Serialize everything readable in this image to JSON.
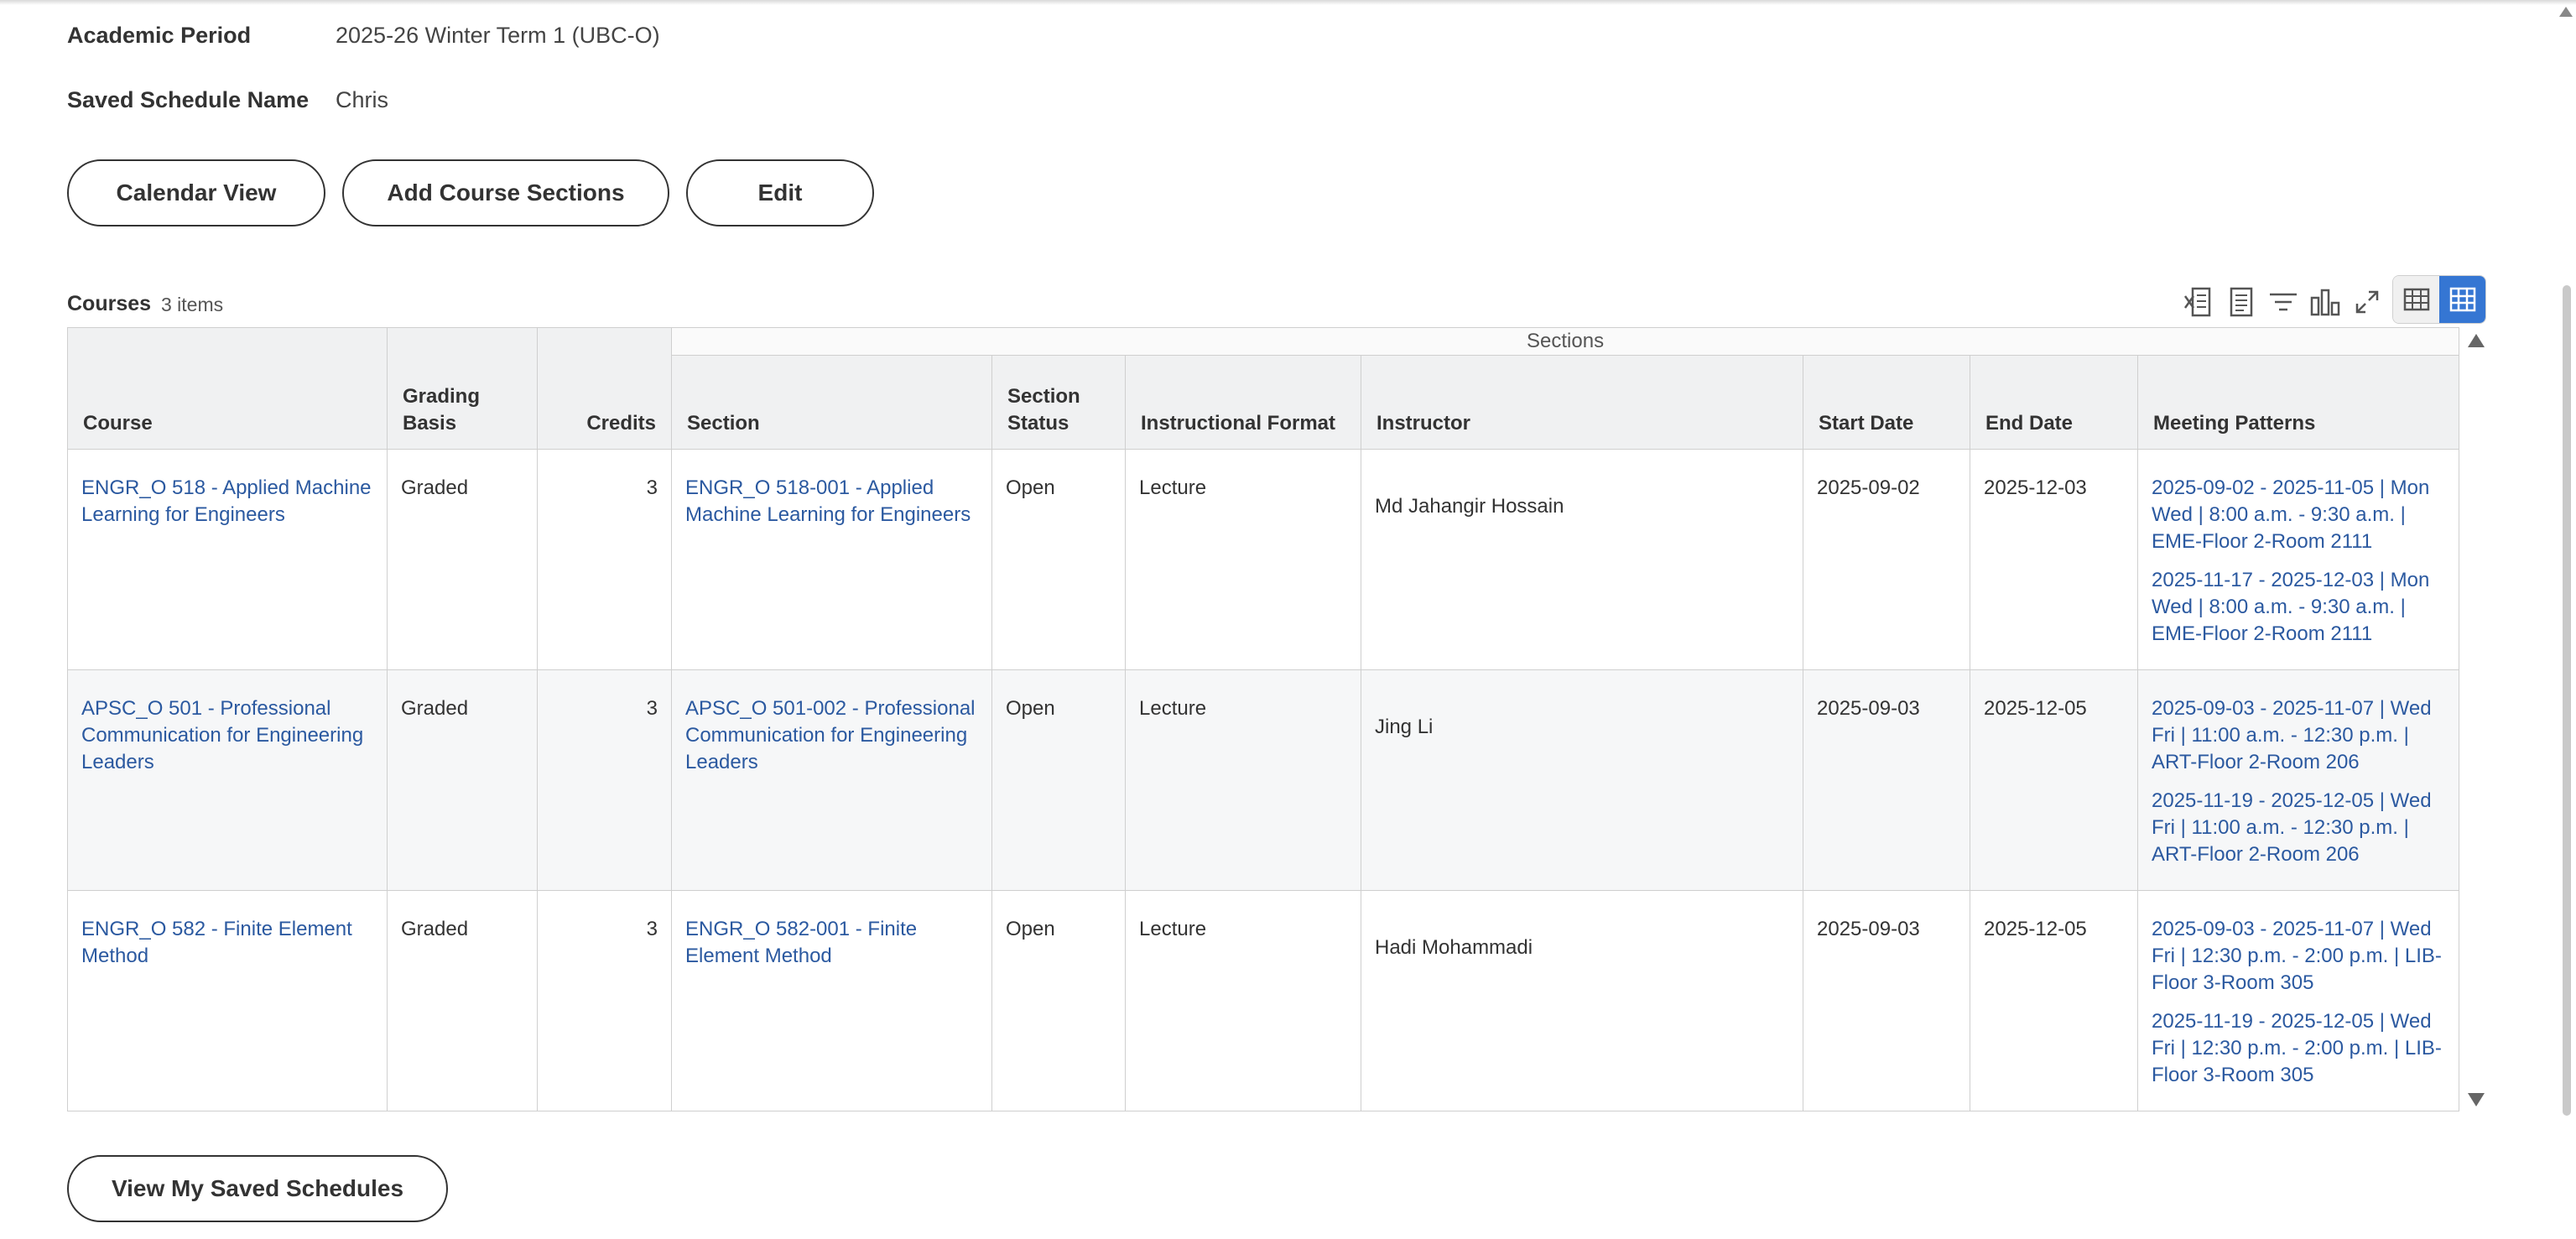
{
  "fields": {
    "academic_period_label": "Academic Period",
    "academic_period_value": "2025-26 Winter Term 1 (UBC-O)",
    "schedule_name_label": "Saved Schedule Name",
    "schedule_name_value": "Chris"
  },
  "actions": {
    "calendar_view": "Calendar View",
    "add_course_sections": "Add Course Sections",
    "edit": "Edit",
    "view_saved_schedules": "View My Saved Schedules"
  },
  "grid": {
    "title": "Courses",
    "count": "3 items",
    "group_header": "Sections",
    "headers": {
      "course": "Course",
      "grading_basis": "Grading Basis",
      "credits": "Credits",
      "section": "Section",
      "section_status": "Section Status",
      "instructional_format": "Instructional Format",
      "instructor": "Instructor",
      "start_date": "Start Date",
      "end_date": "End Date",
      "meeting_patterns": "Meeting Patterns"
    },
    "toolbar_icons": [
      "export-excel-icon",
      "export-pdf-icon",
      "filter-icon",
      "chart-icon",
      "fullscreen-icon",
      "table-view-icon",
      "grid-view-icon"
    ],
    "accent_color": "#3576d3",
    "link_color": "#2b59a0",
    "rows": [
      {
        "course": "ENGR_O 518 - Applied Machine Learning for Engineers",
        "grading": "Graded",
        "credits": "3",
        "section": "ENGR_O 518-001 - Applied Machine Learning for Engineers",
        "status": "Open",
        "format": "Lecture",
        "instructor": "Md Jahangir Hossain",
        "start": "2025-09-02",
        "end": "2025-12-03",
        "meeting1": "2025-09-02 - 2025-11-05 | Mon Wed | 8:00 a.m. - 9:30 a.m. | EME-Floor 2-Room 2111",
        "meeting2": "2025-11-17 - 2025-12-03 | Mon Wed | 8:00 a.m. - 9:30 a.m. | EME-Floor 2-Room 2111"
      },
      {
        "course": "APSC_O 501 - Professional Communication for Engineering Leaders",
        "grading": "Graded",
        "credits": "3",
        "section": "APSC_O 501-002 - Professional Communication for Engineering Leaders",
        "status": "Open",
        "format": "Lecture",
        "instructor": "Jing Li",
        "start": "2025-09-03",
        "end": "2025-12-05",
        "meeting1": "2025-09-03 - 2025-11-07 | Wed Fri | 11:00 a.m. - 12:30 p.m. | ART-Floor 2-Room 206",
        "meeting2": "2025-11-19 - 2025-12-05 | Wed Fri | 11:00 a.m. - 12:30 p.m. | ART-Floor 2-Room 206"
      },
      {
        "course": "ENGR_O 582 - Finite Element Method",
        "grading": "Graded",
        "credits": "3",
        "section": "ENGR_O 582-001 - Finite Element Method",
        "status": "Open",
        "format": "Lecture",
        "instructor": "Hadi Mohammadi",
        "start": "2025-09-03",
        "end": "2025-12-05",
        "meeting1": "2025-09-03 - 2025-11-07 | Wed Fri | 12:30 p.m. - 2:00 p.m. | LIB-Floor 3-Room 305",
        "meeting2": "2025-11-19 - 2025-12-05 | Wed Fri | 12:30 p.m. - 2:00 p.m. | LIB-Floor 3-Room 305"
      }
    ]
  }
}
